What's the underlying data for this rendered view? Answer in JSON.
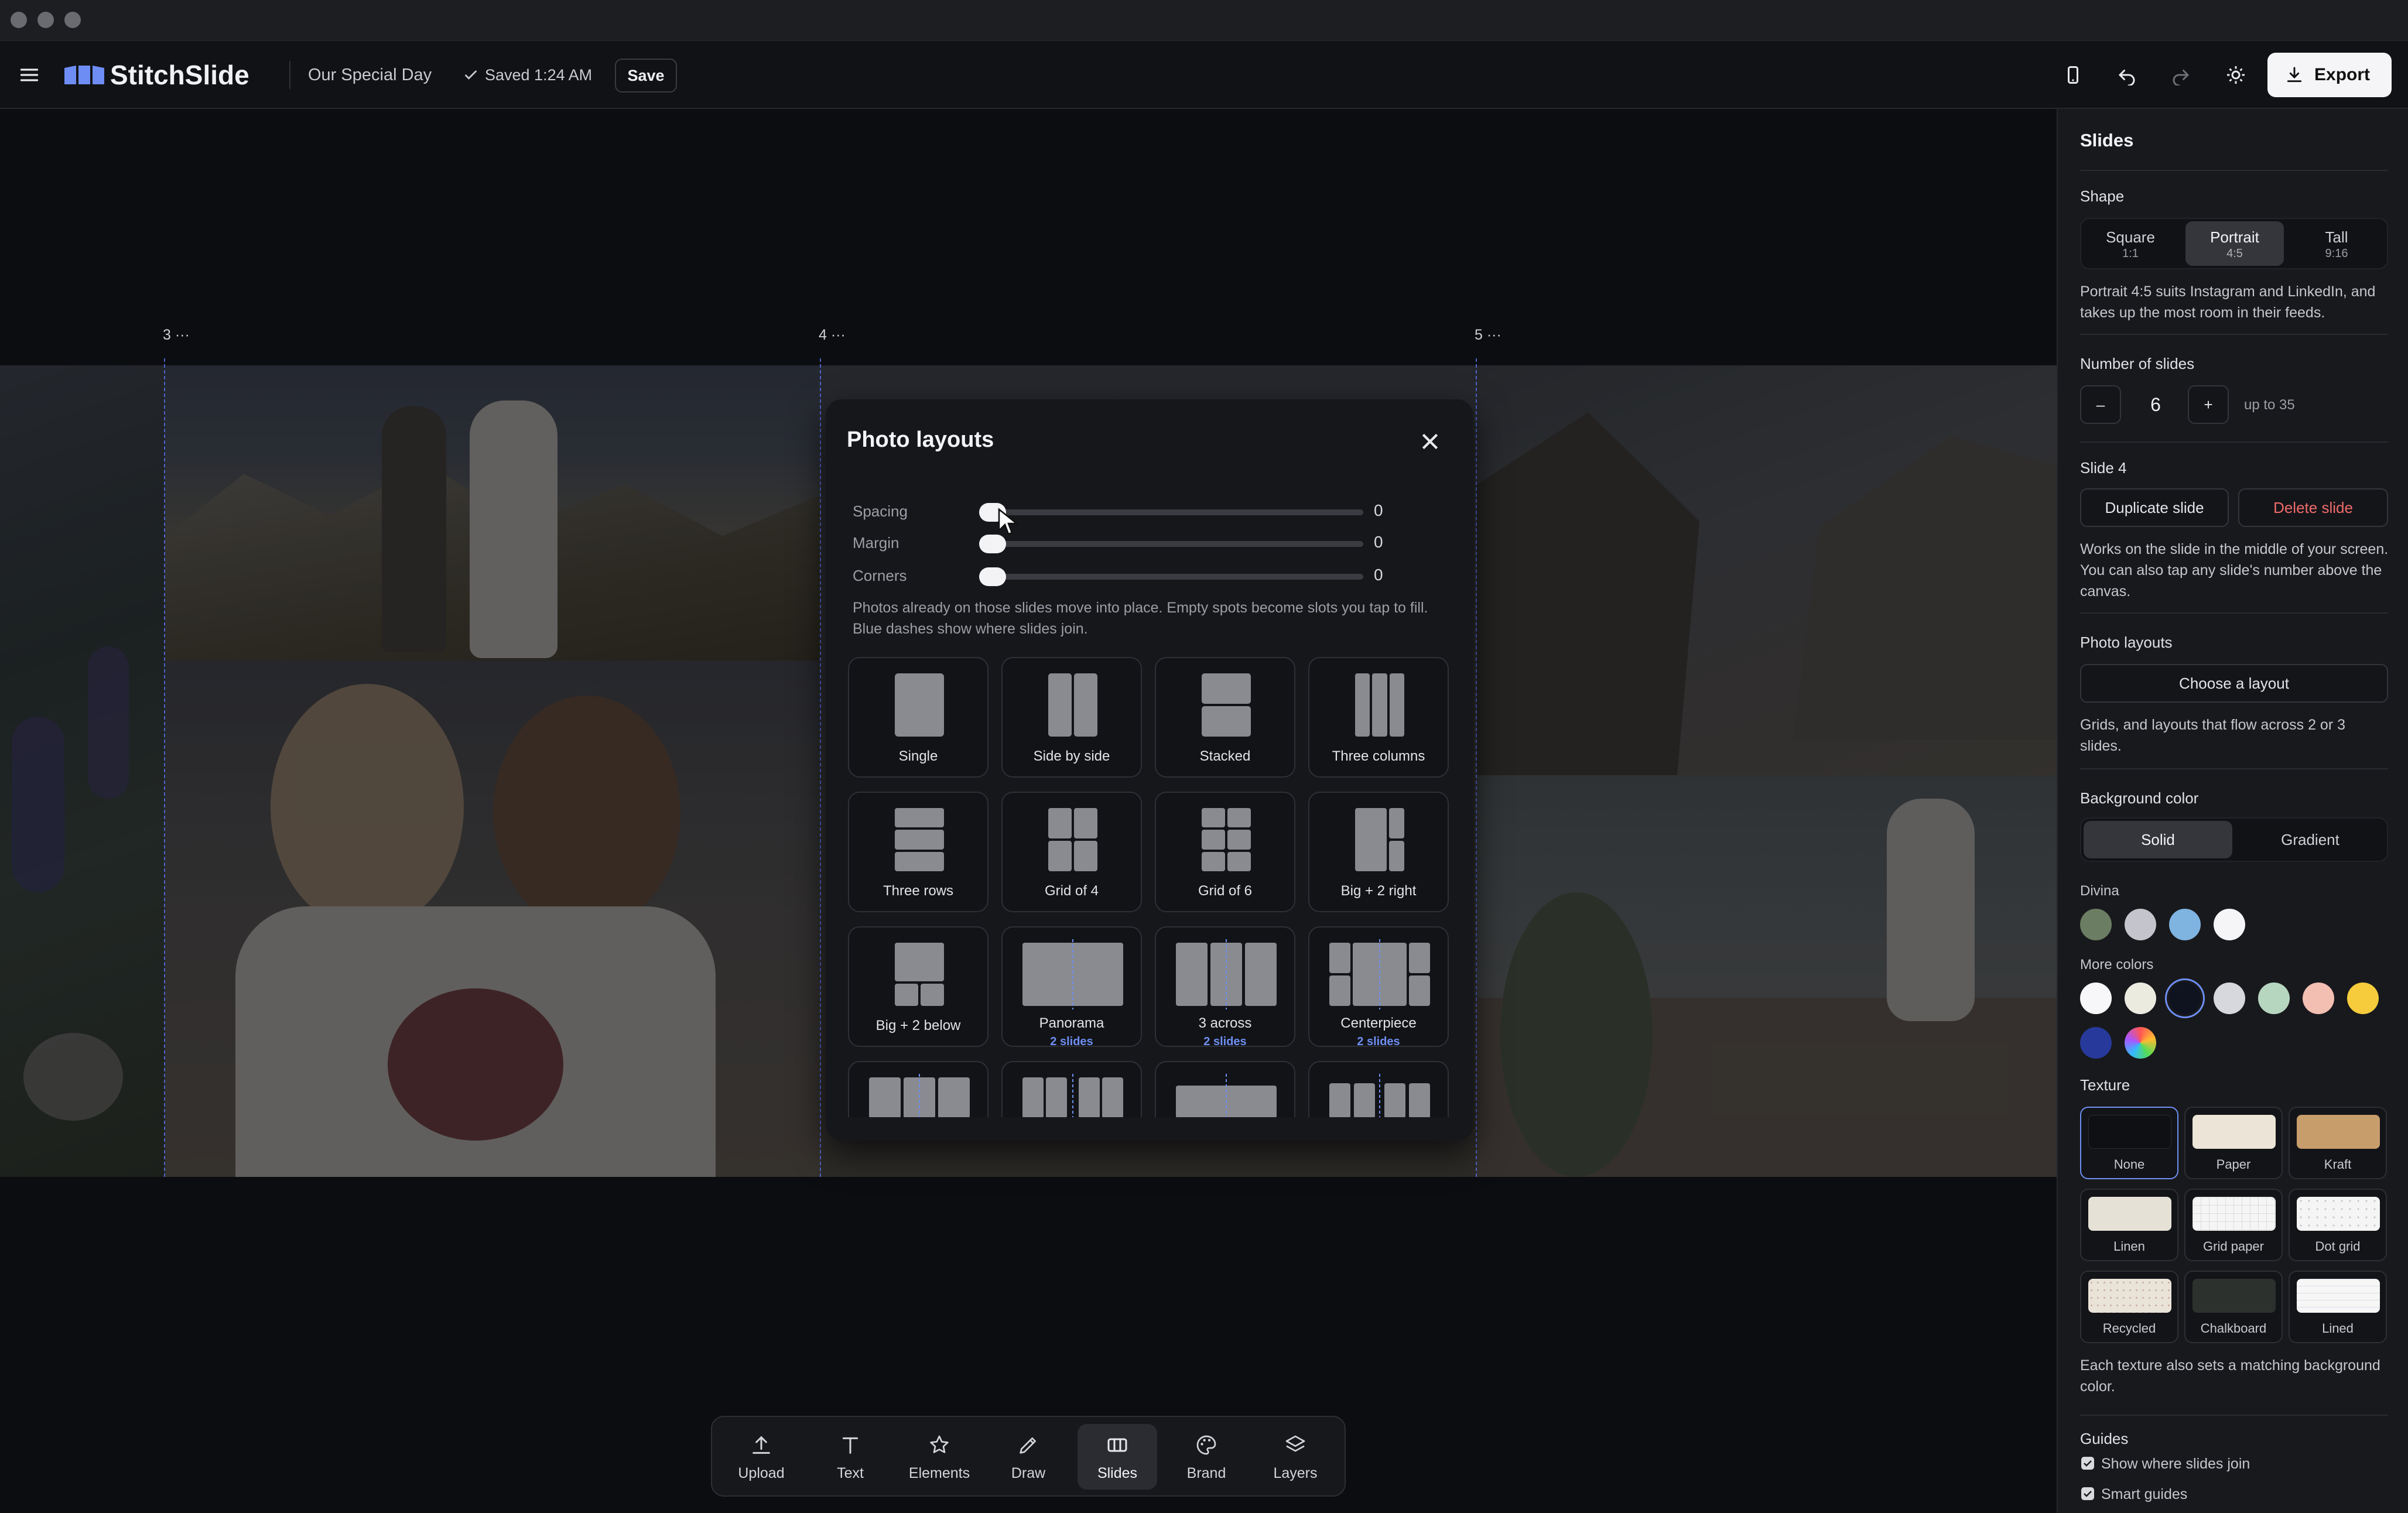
{
  "app": {
    "name": "StitchSlide",
    "document_title": "Our Special Day",
    "saved_status": "Saved 1:24 AM",
    "save_label": "Save",
    "export_label": "Export"
  },
  "canvas": {
    "slide_numbers": [
      "3 ···",
      "4 ···",
      "5 ···"
    ]
  },
  "modal": {
    "title": "Photo layouts",
    "sliders": [
      {
        "label": "Spacing",
        "value": "0"
      },
      {
        "label": "Margin",
        "value": "0"
      },
      {
        "label": "Corners",
        "value": "0"
      }
    ],
    "help": "Photos already on those slides move into place. Empty spots become slots you tap to fill. Blue dashes show where slides join.",
    "layouts": [
      {
        "name": "Single",
        "sub": ""
      },
      {
        "name": "Side by side",
        "sub": ""
      },
      {
        "name": "Stacked",
        "sub": ""
      },
      {
        "name": "Three columns",
        "sub": ""
      },
      {
        "name": "Three rows",
        "sub": ""
      },
      {
        "name": "Grid of 4",
        "sub": ""
      },
      {
        "name": "Grid of 6",
        "sub": ""
      },
      {
        "name": "Big + 2 right",
        "sub": ""
      },
      {
        "name": "Big + 2 below",
        "sub": ""
      },
      {
        "name": "Panorama",
        "sub": "2 slides"
      },
      {
        "name": "3 across",
        "sub": "2 slides"
      },
      {
        "name": "Centerpiece",
        "sub": "2 slides"
      }
    ]
  },
  "toolbar": {
    "items": [
      {
        "label": "Upload",
        "icon": "upload-icon"
      },
      {
        "label": "Text",
        "icon": "text-icon"
      },
      {
        "label": "Elements",
        "icon": "star-icon"
      },
      {
        "label": "Draw",
        "icon": "pencil-icon"
      },
      {
        "label": "Slides",
        "icon": "slides-icon",
        "active": true
      },
      {
        "label": "Brand",
        "icon": "palette-icon"
      },
      {
        "label": "Layers",
        "icon": "layers-icon"
      }
    ]
  },
  "panel": {
    "title": "Slides",
    "shape": {
      "label": "Shape",
      "options": [
        {
          "name": "Square",
          "ratio": "1:1"
        },
        {
          "name": "Portrait",
          "ratio": "4:5",
          "selected": true
        },
        {
          "name": "Tall",
          "ratio": "9:16"
        }
      ],
      "note": "Portrait 4:5 suits Instagram and LinkedIn, and takes up the most room in their feeds."
    },
    "number_of_slides": {
      "label": "Number of slides",
      "minus": "–",
      "value": "6",
      "plus": "+",
      "limit": "up to 35"
    },
    "slide": {
      "label": "Slide 4",
      "duplicate": "Duplicate slide",
      "delete": "Delete slide",
      "note": "Works on the slide in the middle of your screen. You can also tap any slide's number above the canvas."
    },
    "photo_layouts": {
      "label": "Photo layouts",
      "button": "Choose a layout",
      "note": "Grids, and layouts that flow across 2 or 3 slides."
    },
    "background": {
      "label": "Background color",
      "modes": [
        "Solid",
        "Gradient"
      ],
      "palette_name": "Divina",
      "palette": [
        "#6b7d62",
        "#c4c5cc",
        "#7fb3e0",
        "#f5f5f7"
      ],
      "more_label": "More colors",
      "more": [
        "#f7f7f9",
        "#ebebe0",
        "#0f1320",
        "#d6d8de",
        "#b6d6c0",
        "#f2bfb2",
        "#f6cc3c",
        "#27399a"
      ],
      "selected": "#0f1320"
    },
    "texture": {
      "label": "Texture",
      "items": [
        {
          "name": "None",
          "swatch": "#0f1014"
        },
        {
          "name": "Paper",
          "swatch": "#ece4d6"
        },
        {
          "name": "Kraft",
          "swatch": "#c89d6c"
        },
        {
          "name": "Linen",
          "swatch": "#e6e1d6"
        },
        {
          "name": "Grid paper",
          "swatch": "#f5f5f5"
        },
        {
          "name": "Dot grid",
          "swatch": "#f5f5f5"
        },
        {
          "name": "Recycled",
          "swatch": "#e9e3d8"
        },
        {
          "name": "Chalkboard",
          "swatch": "#2c312e"
        },
        {
          "name": "Lined",
          "swatch": "#f6f6f6"
        }
      ],
      "note": "Each texture also sets a matching background color."
    },
    "guides": {
      "label": "Guides",
      "items": [
        "Show where slides join",
        "Smart guides"
      ]
    }
  }
}
